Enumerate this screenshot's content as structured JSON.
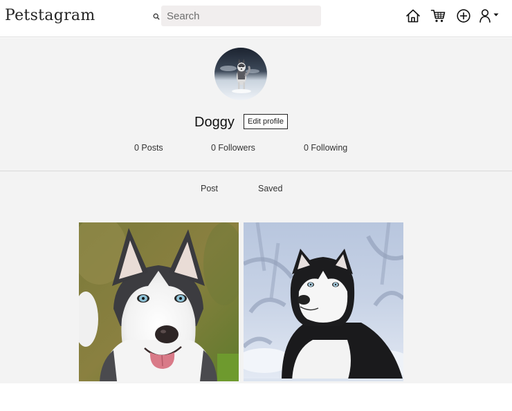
{
  "app": {
    "logo_text": "Petstagram"
  },
  "search": {
    "placeholder": "Search",
    "value": ""
  },
  "nav": {
    "icons": [
      "home-icon",
      "cart-icon",
      "add-icon",
      "user-icon",
      "caret-down-icon"
    ]
  },
  "profile": {
    "username": "Doggy",
    "edit_label": "Edit profile",
    "posts_text": "0 Posts",
    "followers_text": "0 Followers",
    "following_text": "0 Following"
  },
  "tabs": [
    {
      "label": "Post"
    },
    {
      "label": "Saved"
    }
  ],
  "colors": {
    "page_background": "#f3f3f3",
    "header_background": "#ffffff",
    "search_background": "#f1eeee",
    "text": "#222222"
  }
}
